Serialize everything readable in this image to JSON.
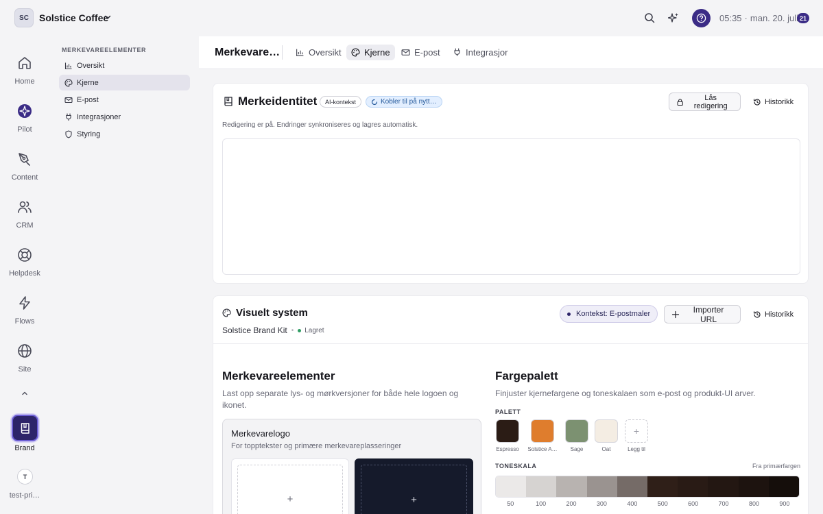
{
  "topbar": {
    "workspace_initials": "SC",
    "workspace_name": "Solstice Coffee",
    "time": "05:35",
    "date": "man. 20. juli",
    "day_badge": "21",
    "accent": "#3b2c86"
  },
  "rail": {
    "items": [
      {
        "label": "Home",
        "icon": "home-icon"
      },
      {
        "label": "Pilot",
        "icon": "pilot-icon"
      },
      {
        "label": "Content",
        "icon": "pen-icon"
      },
      {
        "label": "CRM",
        "icon": "users-icon"
      },
      {
        "label": "Helpdesk",
        "icon": "lifebuoy-icon"
      },
      {
        "label": "Flows",
        "icon": "lightning-icon"
      },
      {
        "label": "Site",
        "icon": "globe-icon"
      }
    ],
    "brand_label": "Brand",
    "user_initial": "T",
    "user_label": "test-pri…"
  },
  "subnav": {
    "heading": "MERKEVAREELEMENTER",
    "items": [
      {
        "label": "Oversikt",
        "icon": "chart-icon"
      },
      {
        "label": "Kjerne",
        "icon": "palette-icon",
        "active": true
      },
      {
        "label": "E-post",
        "icon": "mail-icon"
      },
      {
        "label": "Integrasjoner",
        "icon": "plug-icon"
      },
      {
        "label": "Styring",
        "icon": "shield-icon"
      }
    ]
  },
  "tabbar": {
    "title": "Merkevare…",
    "tabs": [
      {
        "label": "Oversikt",
        "icon": "chart-icon"
      },
      {
        "label": "Kjerne",
        "icon": "palette-icon",
        "active": true
      },
      {
        "label": "E-post",
        "icon": "mail-icon"
      },
      {
        "label": "Integrasjor",
        "icon": "plug-icon"
      }
    ]
  },
  "identity": {
    "title": "Merkeidentitet",
    "ai_badge": "AI-kontekst",
    "sync_badge": "Kobler til på nytt…",
    "lock_button": "Lås redigering",
    "history_button": "Historikk",
    "note": "Redigering er på. Endringer synkroniseres og lagres automatisk."
  },
  "visual": {
    "title": "Visuelt system",
    "kit_name": "Solstice Brand Kit",
    "status": "Lagret",
    "context_pill": "Kontekst: E-postmaler",
    "import_button": "Importer URL",
    "history_button": "Historikk",
    "elements": {
      "title": "Merkevareelementer",
      "description": "Last opp separate lys- og mørkversjoner for både hele logoen og ikonet.",
      "logo_title": "Merkevarelogo",
      "logo_description": "For topptekster og primære merkevareplasseringer",
      "plus": "+"
    },
    "palette": {
      "title": "Fargepalett",
      "description": "Finjuster kjernefargene og toneskalaen som e-post og produkt-UI arver.",
      "heading": "PALETT",
      "swatches": [
        {
          "label": "Espresso",
          "color": "#2b1c15"
        },
        {
          "label": "Solstice A…",
          "color": "#df7d2d"
        },
        {
          "label": "Sage",
          "color": "#7c9171"
        },
        {
          "label": "Oat",
          "color": "#f4ede3"
        }
      ],
      "add_label": "Legg til",
      "tone_heading": "TONESKALA",
      "tone_note": "Fra primærfargen",
      "tones": [
        {
          "step": "50",
          "color": "#ebe9e8"
        },
        {
          "step": "100",
          "color": "#d6d3d1"
        },
        {
          "step": "200",
          "color": "#b8b3b0"
        },
        {
          "step": "300",
          "color": "#9a9390"
        },
        {
          "step": "400",
          "color": "#756b67"
        },
        {
          "step": "500",
          "color": "#2f1f18"
        },
        {
          "step": "600",
          "color": "#291b15"
        },
        {
          "step": "700",
          "color": "#231712"
        },
        {
          "step": "800",
          "color": "#1d130f"
        },
        {
          "step": "900",
          "color": "#150e0b"
        }
      ]
    }
  }
}
